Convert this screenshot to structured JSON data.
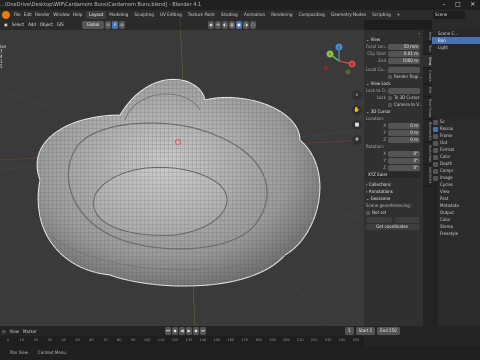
{
  "window": {
    "title": "...\\OneDrive\\Desktop\\WIP\\Cardamom Buns\\Cardamom Buns.blend] - Blender 4.1",
    "controls": [
      "–",
      "□",
      "✕"
    ]
  },
  "topbar": {
    "menu": [
      "File",
      "Edit",
      "Render",
      "Window",
      "Help"
    ],
    "workspaces": [
      "Layout",
      "Modeling",
      "Sculpting",
      "UV Editing",
      "Texture Paint",
      "Shading",
      "Animation",
      "Rendering",
      "Compositing",
      "Geometry Nodes",
      "Scripting"
    ],
    "active_workspace": "Layout",
    "scene": "Scene"
  },
  "viewport": {
    "menu": [
      "Select",
      "Add",
      "Object",
      "GIS"
    ],
    "transform": "Global",
    "overlay_lines": [
      "ive",
      "",
      "",
      "",
      "",
      "7",
      "4",
      "1",
      "5"
    ],
    "gizmo_axes": [
      "X",
      "Y",
      "Z"
    ],
    "nav_icons": [
      "zoom-icon",
      "hand-icon",
      "camera-icon",
      "grid-icon"
    ]
  },
  "npanel": {
    "view": {
      "header": "View",
      "focal_label": "Focal Len...",
      "focal_value": "50 mm",
      "clip_start_label": "Clip Start",
      "clip_start_value": "0.01 m",
      "end_label": "End",
      "end_value": "1000 m",
      "local_camera_label": "Local Ca...",
      "render_region_label": "Render Regi..."
    },
    "view_lock": {
      "header": "View Lock",
      "lock_to_label": "Lock to O...",
      "lock_label": "Lock",
      "to_3d_cursor": "To 3D Cursor",
      "camera_to_view": "Camera to V..."
    },
    "cursor": {
      "header": "3D Cursor",
      "location_label": "Location:",
      "loc_x": "0 m",
      "loc_y": "0 m",
      "loc_z": "0 m",
      "rotation_label": "Rotation:",
      "rot_x": "0°",
      "rot_y": "0°",
      "rot_z": "0°",
      "mode": "XYZ Euler"
    },
    "collections_header": "Collections",
    "annotations_header": "Annotations",
    "geoscene": {
      "header": "Geoscene",
      "georef_label": "Scene georeferencing :",
      "not_set": "Not set",
      "get_coords": "Get coordinates"
    },
    "tabs": [
      "Item",
      "Tool",
      "View",
      "Create",
      "Edit",
      "Real Snow",
      "BlenderKit",
      "Sketchfab",
      "MACHIN3"
    ]
  },
  "outliner": {
    "items": [
      "Scene C...",
      "Bun",
      "Light"
    ]
  },
  "properties": {
    "items": [
      "Sc",
      "Resolu",
      "Frame",
      "Out",
      "Format",
      "Color",
      "Depth",
      "Compr",
      "Image",
      "Cycles",
      "View",
      "Post",
      "Metadata",
      "Output",
      "Color",
      "Stereo",
      "Freestyle"
    ]
  },
  "timeline": {
    "menu": [
      "View",
      "Marker"
    ],
    "current_frame": "1",
    "start_label": "Start",
    "start_value": "1",
    "end_label": "End",
    "end_value": "250",
    "ruler_marks": [
      "0",
      "10",
      "20",
      "30",
      "40",
      "50",
      "60",
      "70",
      "80",
      "90",
      "100",
      "110",
      "120",
      "130",
      "140",
      "150",
      "160",
      "170",
      "180",
      "190",
      "200",
      "210",
      "220",
      "230",
      "240",
      "250"
    ]
  },
  "statusbar": {
    "items": [
      "Pan View",
      "Context Menu"
    ]
  }
}
